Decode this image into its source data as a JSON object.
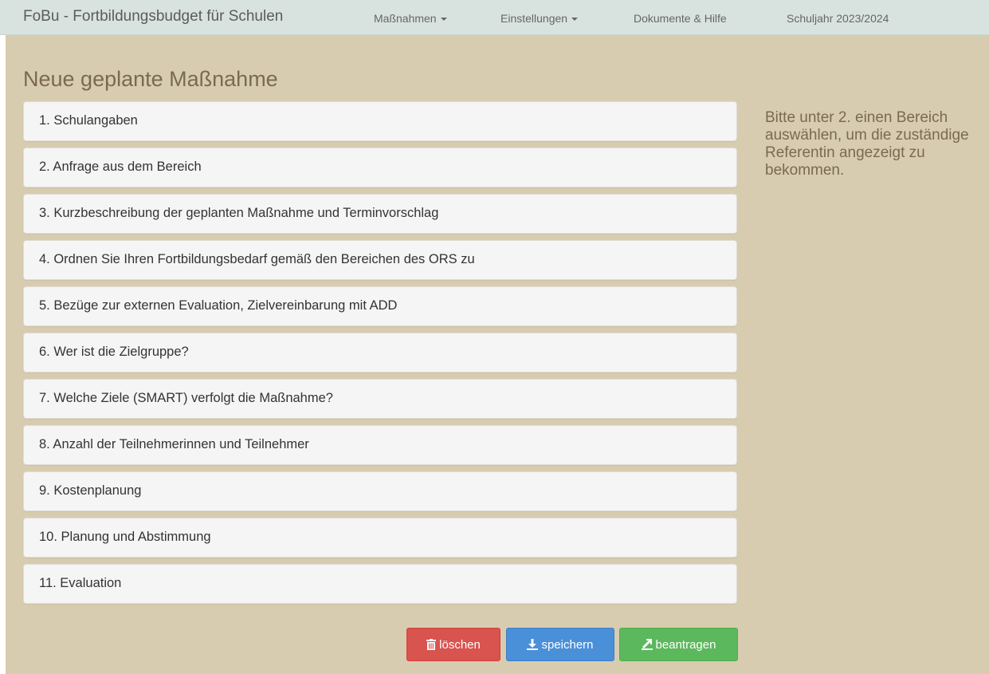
{
  "navbar": {
    "brand": "FoBu - Fortbildungsbudget für Schulen",
    "items": [
      {
        "label": "Maßnahmen"
      },
      {
        "label": "Einstellungen"
      },
      {
        "label": "Dokumente & Hilfe"
      },
      {
        "label": "Schuljahr 2023/2024"
      }
    ]
  },
  "page": {
    "title": "Neue geplante Maßnahme",
    "hint": "Bitte unter 2. einen Bereich auswählen, um die zuständige Referentin angezeigt zu bekommen."
  },
  "sections": [
    {
      "label": "1. Schulangaben"
    },
    {
      "label": "2. Anfrage aus dem Bereich"
    },
    {
      "label": "3. Kurzbeschreibung der geplanten Maßnahme und Terminvorschlag"
    },
    {
      "label": "4. Ordnen Sie Ihren Fortbildungsbedarf gemäß den Bereichen des ORS zu"
    },
    {
      "label": "5. Bezüge zur externen Evaluation, Zielvereinbarung mit ADD"
    },
    {
      "label": "6. Wer ist die Zielgruppe?"
    },
    {
      "label": "7. Welche Ziele (SMART) verfolgt die Maßnahme?"
    },
    {
      "label": "8. Anzahl der Teilnehmerinnen und Teilnehmer"
    },
    {
      "label": "9. Kostenplanung"
    },
    {
      "label": "10. Planung und Abstimmung"
    },
    {
      "label": "11. Evaluation"
    }
  ],
  "actions": {
    "delete": {
      "label": "löschen",
      "icon": "trash-icon",
      "color": "#d9534f"
    },
    "save": {
      "label": "speichern",
      "icon": "download-icon",
      "color": "#4a90d9"
    },
    "apply": {
      "label": "beantragen",
      "icon": "export-icon",
      "color": "#5cb85c"
    }
  }
}
